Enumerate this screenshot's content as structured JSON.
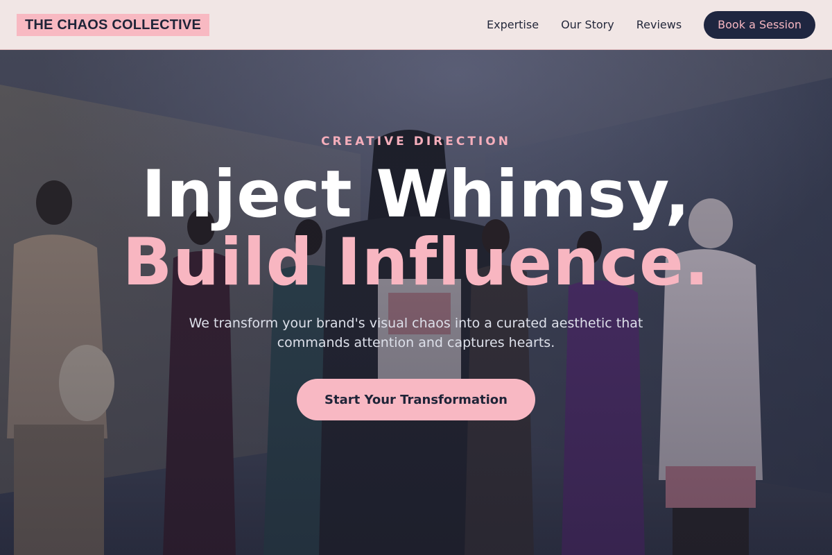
{
  "brand": {
    "name": "THE CHAOS COLLECTIVE"
  },
  "nav": {
    "links": [
      {
        "label": "Expertise"
      },
      {
        "label": "Our Story"
      },
      {
        "label": "Reviews"
      }
    ],
    "cta_label": "Book a Session"
  },
  "hero": {
    "eyebrow": "CREATIVE DIRECTION",
    "headline_line1": "Inject Whimsy,",
    "headline_line2": "Build Influence.",
    "subheadline": "We transform your brand's visual chaos into a curated aesthetic that commands attention and captures hearts.",
    "cta_label": "Start Your Transformation",
    "background_image": "group of fashionably dressed people in a studio"
  },
  "colors": {
    "accent_pink": "#f8b8c3",
    "navy": "#1f2640",
    "nav_background": "#f1e6e5",
    "white": "#ffffff"
  }
}
